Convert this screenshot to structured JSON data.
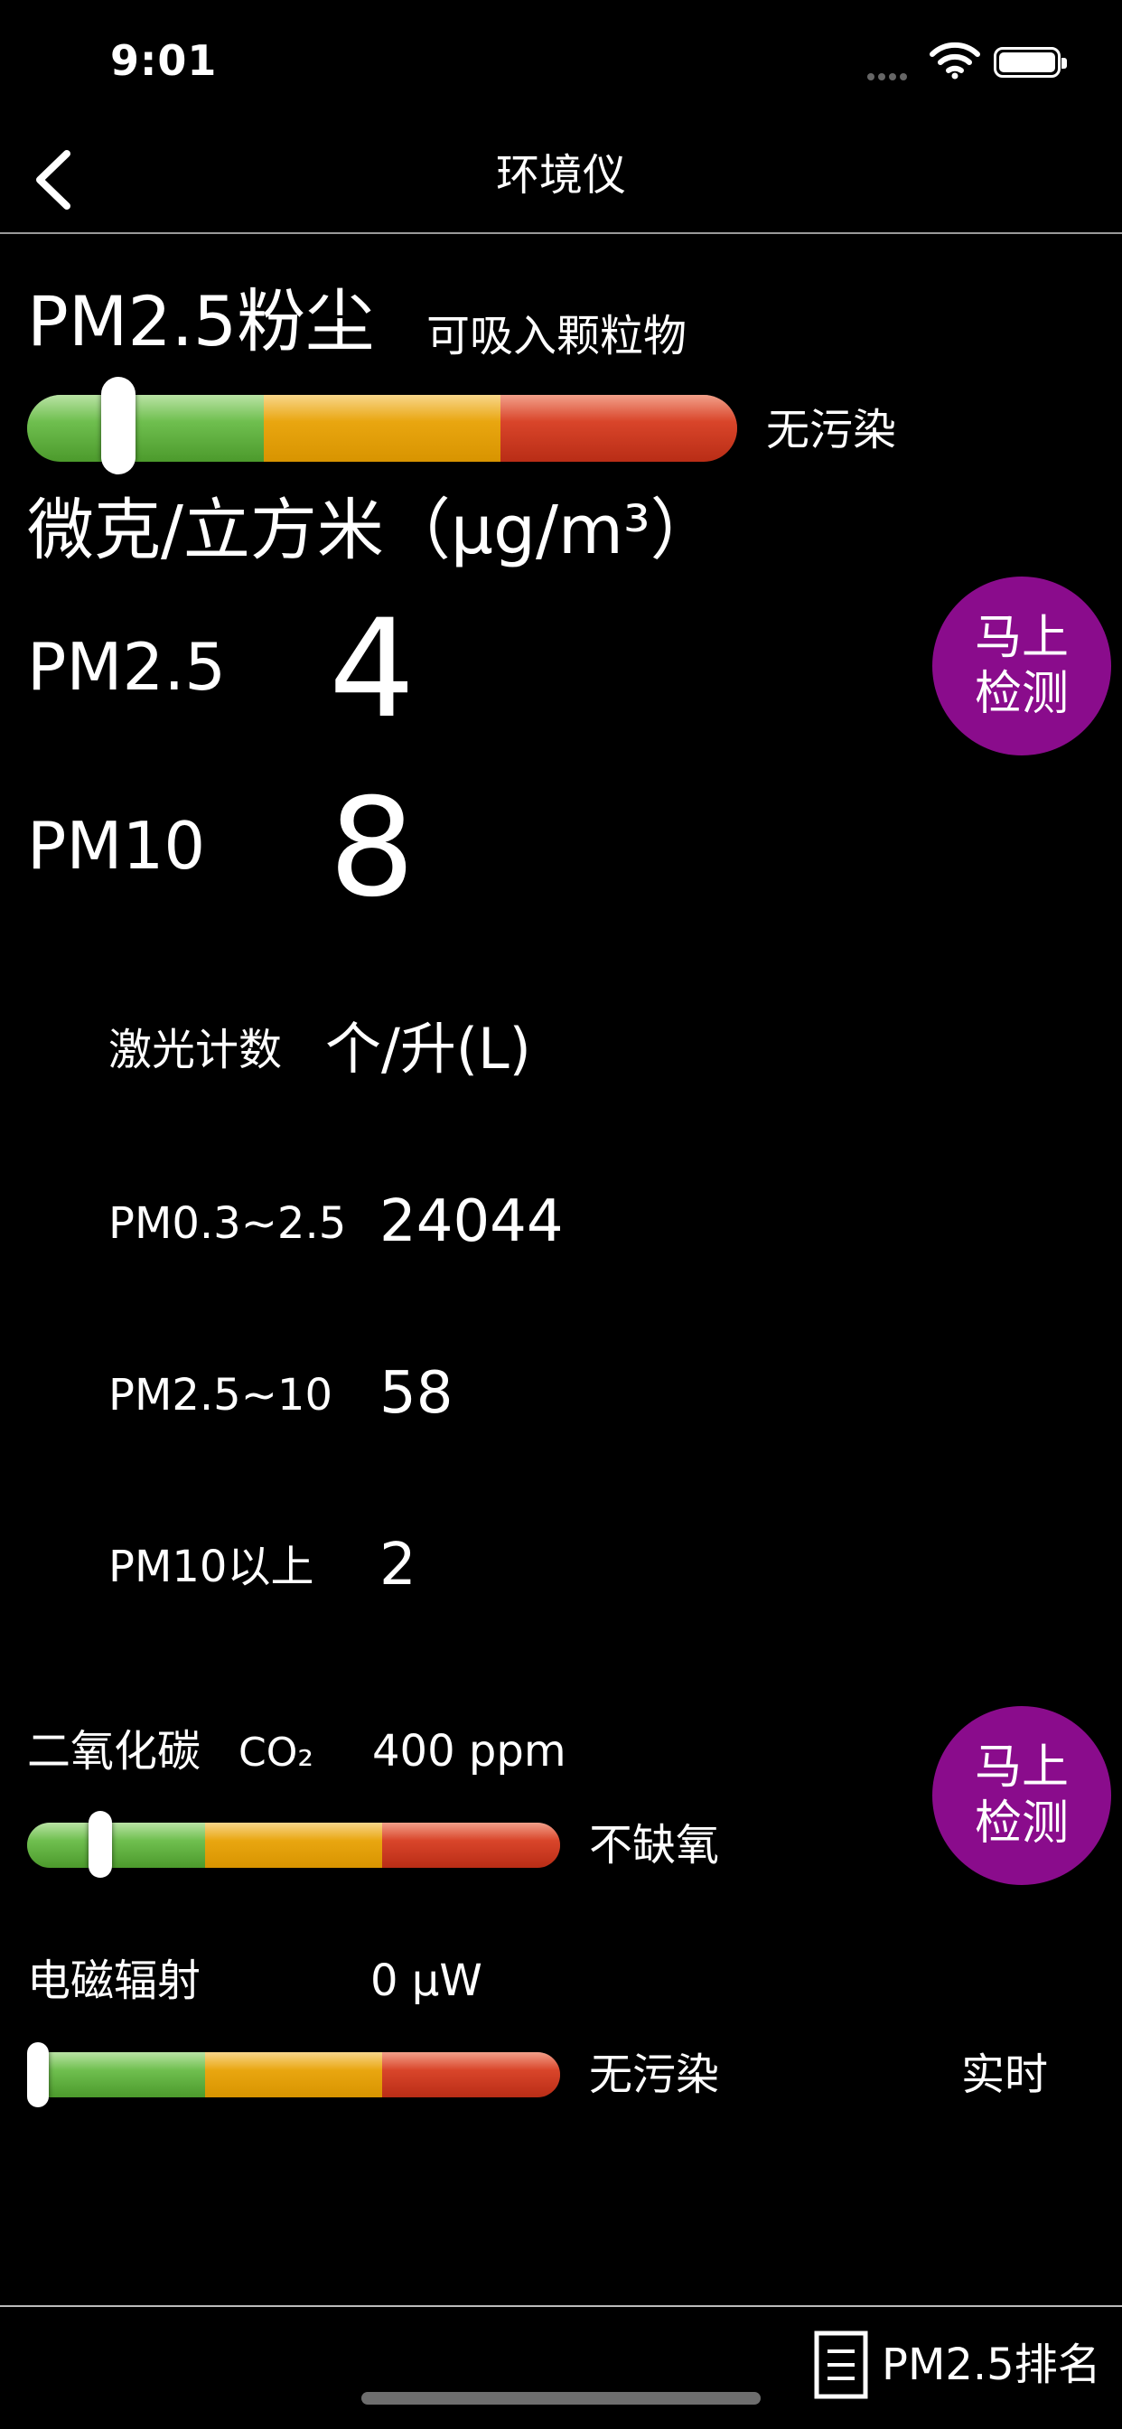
{
  "status_bar": {
    "time": "9:01"
  },
  "nav": {
    "title": "环境仪"
  },
  "pm25_section": {
    "title": "PM2.5粉尘",
    "subtitle": "可吸入颗粒物",
    "status": "无污染",
    "level": 0.11,
    "unit_label": "微克/立方米（µg/m³）",
    "pm25_label": "PM2.5",
    "pm25_value": "4",
    "pm10_label": "PM10",
    "pm10_value": "8",
    "detect_button": "马上检测"
  },
  "laser_count": {
    "label": "激光计数",
    "unit": "个/升(L)",
    "rows": [
      {
        "label": "PM0.3~2.5",
        "value": "24044"
      },
      {
        "label": "PM2.5~10",
        "value": "58"
      },
      {
        "label": "PM10以上",
        "value": "2"
      }
    ]
  },
  "co2_section": {
    "title": "二氧化碳",
    "formula": "CO₂",
    "value": "400 ppm",
    "status": "不缺氧",
    "level": 0.12,
    "detect_button": "马上检测"
  },
  "emr_section": {
    "title": "电磁辐射",
    "value": "0 µW",
    "status": "无污染",
    "level": 0.0,
    "mode": "实时"
  },
  "tab_bar": {
    "ranking_label": "PM2.5排名"
  },
  "colors": {
    "background": "#000000",
    "accent_purple": "#8a0c8c",
    "gauge_green": "#6fbf4f",
    "gauge_yellow": "#e9a610",
    "gauge_red": "#d9452a"
  }
}
